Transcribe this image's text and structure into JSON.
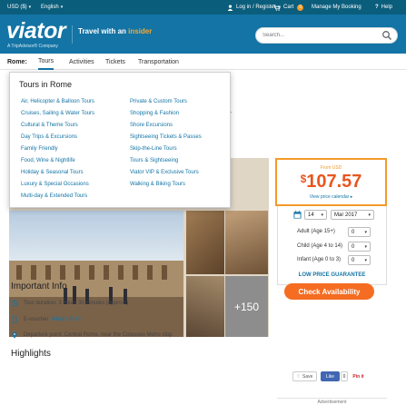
{
  "topbar": {
    "currency": "USD ($)",
    "language": "English",
    "login": "Log in / Register",
    "cart": "Cart",
    "cart_count": "0",
    "manage": "Manage My Booking",
    "help": "Help"
  },
  "header": {
    "logo": "viator",
    "logo_sub": "A TripAdvisor® Company",
    "tagline_prefix": "Travel with an ",
    "tagline_accent": "insider",
    "search_placeholder": "Search..."
  },
  "nav": {
    "city": "Rome:",
    "items": [
      "Tours",
      "Activities",
      "Tickets",
      "Transportation"
    ]
  },
  "dropdown": {
    "title": "Tours in Rome",
    "left": [
      "Air, Helicopter & Balloon Tours",
      "Cruises, Sailing & Water Tours",
      "Cultural & Theme Tours",
      "Day Trips & Excursions",
      "Family Friendly",
      "Food, Wine & Nightlife",
      "Holiday & Seasonal Tours",
      "Luxury & Special Occasions",
      "Multi-day & Extended Tours"
    ],
    "right": [
      "Private & Custom Tours",
      "Shopping & Fashion",
      "Shore Excursions",
      "Sightseeing Tickets & Passes",
      "Skip-the-Line Tours",
      "Tours & Sightseeing",
      "Viator VIP & Exclusive Tours",
      "Walking & Biking Tours"
    ]
  },
  "product": {
    "title_fragment": "ber",
    "more_photos": "+150"
  },
  "info": {
    "heading": "Important Info",
    "duration": "Tour duration: 3 hours 30 minutes (approx.)",
    "voucher": "E-voucher",
    "voucher_link": "What's this?",
    "departure": "Departure point: Central Rome, near the Colosseo Metro stop",
    "highlights": "Highlights"
  },
  "booking": {
    "from": "From USD",
    "currency_sign": "$",
    "price": "107.57",
    "calendar_link": "View price calendar ▸",
    "day": "14",
    "month": "Mar 2017",
    "adult_label": "Adult (Age 15+)",
    "child_label": "Child (Age 4 to 14)",
    "infant_label": "Infant (Age 0 to 3)",
    "adult_count": "0",
    "child_count": "0",
    "infant_count": "0",
    "low_price": "LOW PRICE GUARANTEE",
    "check_availability": "Check Availability"
  },
  "share": {
    "save": "Save",
    "like": "Like",
    "like_count": "0",
    "pin": "Pin it"
  },
  "advertisement": "Advertisement",
  "colors": {
    "header_blue": "#1374a5",
    "topbar_blue": "#0b5d7c",
    "accent_orange": "#f46d22",
    "price_orange": "#e8561f"
  }
}
